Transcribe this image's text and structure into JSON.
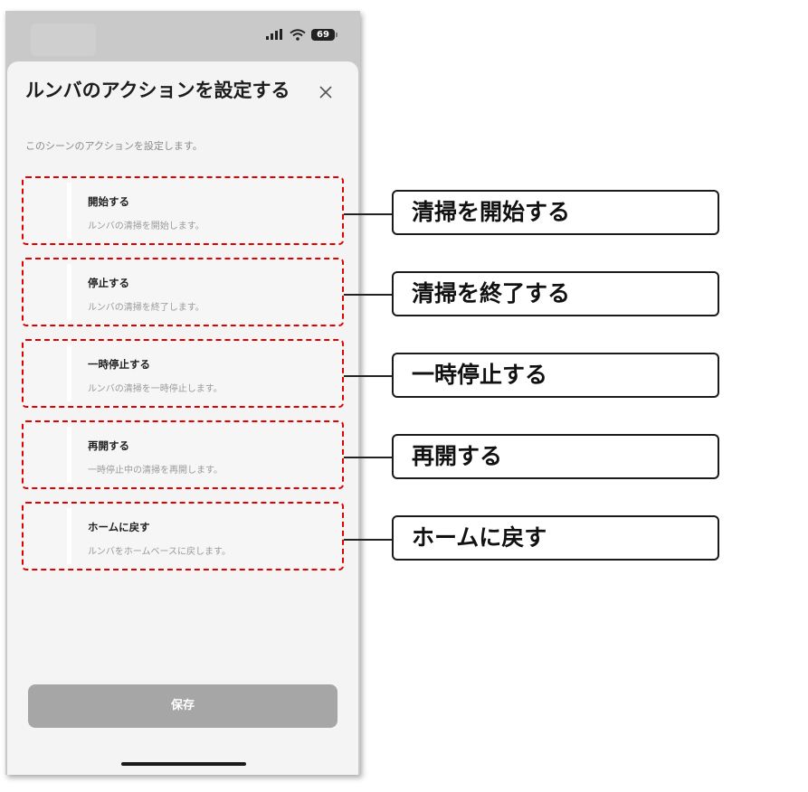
{
  "status_bar": {
    "battery": "69",
    "icons": [
      "signal-icon",
      "wifi-icon",
      "battery-icon"
    ]
  },
  "sheet": {
    "title": "ルンバのアクションを設定する",
    "subtitle": "このシーンのアクションを設定します。",
    "close_icon": "close-icon",
    "actions": [
      {
        "title": "開始する",
        "description": "ルンバの清掃を開始します。"
      },
      {
        "title": "停止する",
        "description": "ルンバの清掃を終了します。"
      },
      {
        "title": "一時停止する",
        "description": "ルンバの清掃を一時停止します。"
      },
      {
        "title": "再開する",
        "description": "一時停止中の清掃を再開します。"
      },
      {
        "title": "ホームに戻す",
        "description": "ルンバをホームベースに戻します。"
      }
    ],
    "save_label": "保存"
  },
  "callouts": [
    "清掃を開始する",
    "清掃を終了する",
    "一時停止する",
    "再開する",
    "ホームに戻す"
  ],
  "colors": {
    "highlight_dash": "#e00000",
    "save_button": "#a6a6a6",
    "sheet_background": "#f4f4f4"
  }
}
